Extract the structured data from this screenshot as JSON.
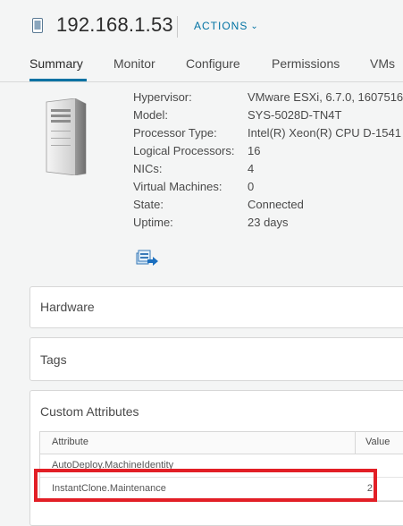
{
  "header": {
    "host_name": "192.168.1.53",
    "actions_label": "ACTIONS",
    "host_icon": "host-icon"
  },
  "tabs": [
    {
      "label": "Summary",
      "active": true
    },
    {
      "label": "Monitor"
    },
    {
      "label": "Configure"
    },
    {
      "label": "Permissions"
    },
    {
      "label": "VMs"
    }
  ],
  "summary": {
    "properties": [
      {
        "key": "Hypervisor:",
        "value": "VMware ESXi, 6.7.0, 1607516"
      },
      {
        "key": "Model:",
        "value": "SYS-5028D-TN4T"
      },
      {
        "key": "Processor Type:",
        "value": "Intel(R) Xeon(R) CPU D-1541"
      },
      {
        "key": "Logical Processors:",
        "value": "16"
      },
      {
        "key": "NICs:",
        "value": "4"
      },
      {
        "key": "Virtual Machines:",
        "value": "0"
      },
      {
        "key": "State:",
        "value": "Connected"
      },
      {
        "key": "Uptime:",
        "value": "23 days"
      }
    ]
  },
  "cards": {
    "hardware": "Hardware",
    "tags": "Tags",
    "custom_attributes": {
      "title": "Custom Attributes",
      "columns": [
        "Attribute",
        "Value"
      ],
      "rows": [
        {
          "attribute": "AutoDeploy.MachineIdentity",
          "value": ""
        },
        {
          "attribute": "InstantClone.Maintenance",
          "value": "2"
        }
      ]
    }
  },
  "colors": {
    "accent": "#0072a3",
    "highlight": "#e21f26"
  }
}
